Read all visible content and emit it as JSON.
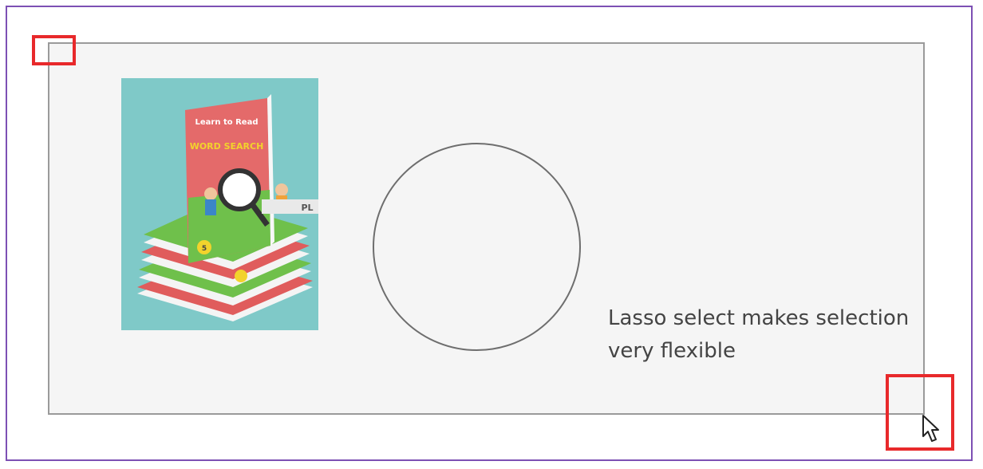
{
  "caption": {
    "line1": "Lasso select makes selection",
    "line2": "very flexible"
  },
  "book": {
    "title_line1": "Learn to Read",
    "title_line2": "WORD SEARCH",
    "badge": "PL"
  },
  "icons": {
    "cursor": "mouse-pointer-icon"
  },
  "colors": {
    "frame": "#7d50b4",
    "handle": "#e8292b",
    "canvas_bg": "#f5f5f5",
    "book_bg": "#7fc9c8",
    "book_cover": "#e46a6a",
    "book_green": "#6fc04b"
  }
}
